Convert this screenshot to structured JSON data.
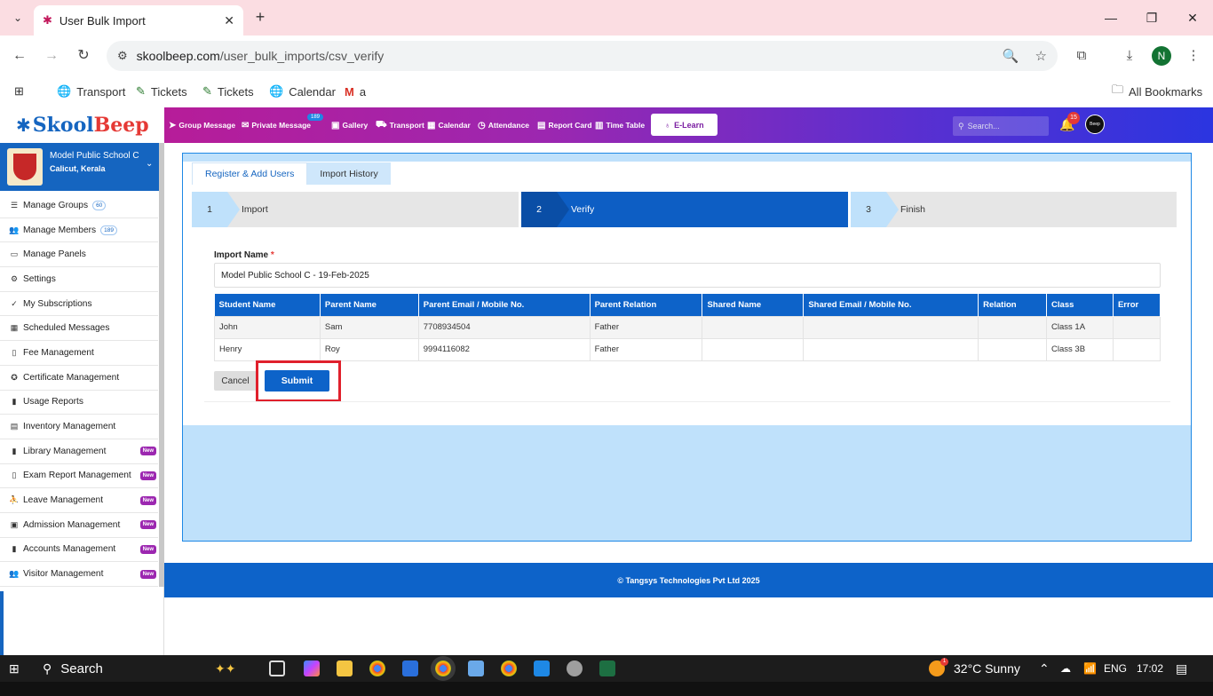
{
  "browser": {
    "tab_title": "User Bulk Import",
    "url_host": "skoolbeep.com",
    "url_path": "/user_bulk_imports/csv_verify",
    "profile_initial": "N",
    "bookmarks": [
      "Transport",
      "Tickets",
      "Tickets",
      "Calendar",
      "a"
    ],
    "all_bookmarks": "All Bookmarks"
  },
  "app": {
    "logo_skool": "Skool",
    "logo_beep": "Beep",
    "nav": [
      "Group Message",
      "Private Message",
      "Gallery",
      "Transport",
      "Calendar",
      "Attendance",
      "Report Card",
      "Time Table"
    ],
    "private_message_badge": "189",
    "elearn": "E-Learn",
    "search_placeholder": "Search...",
    "notification_count": "15",
    "avatar_text": "Beep"
  },
  "sidebar": {
    "school_name": "Model Public School C",
    "school_location": "Calicut, Kerala",
    "items": [
      {
        "label": "Manage Groups",
        "count": "60",
        "icon": "list-icon"
      },
      {
        "label": "Manage Members",
        "count": "189",
        "icon": "users-icon"
      },
      {
        "label": "Manage Panels",
        "icon": "monitor-icon"
      },
      {
        "label": "Settings",
        "icon": "gear-icon"
      },
      {
        "label": "My Subscriptions",
        "icon": "check-icon"
      },
      {
        "label": "Scheduled Messages",
        "icon": "calendar-icon"
      },
      {
        "label": "Fee Management",
        "icon": "doc-icon"
      },
      {
        "label": "Certificate Management",
        "icon": "award-icon"
      },
      {
        "label": "Usage Reports",
        "icon": "chart-icon"
      },
      {
        "label": "Inventory Management",
        "icon": "box-icon"
      },
      {
        "label": "Library Management",
        "badge": "New",
        "icon": "book-icon"
      },
      {
        "label": "Exam Report Management",
        "badge": "New",
        "icon": "file-icon"
      },
      {
        "label": "Leave Management",
        "badge": "New",
        "icon": "leave-icon"
      },
      {
        "label": "Admission Management",
        "badge": "New",
        "icon": "admission-icon"
      },
      {
        "label": "Accounts Management",
        "badge": "New",
        "icon": "accounts-icon"
      },
      {
        "label": "Visitor Management",
        "badge": "New",
        "icon": "visitor-icon"
      }
    ]
  },
  "main": {
    "tabs": [
      "Register & Add Users",
      "Import History"
    ],
    "steps": [
      {
        "num": "1",
        "label": "Import"
      },
      {
        "num": "2",
        "label": "Verify"
      },
      {
        "num": "3",
        "label": "Finish"
      }
    ],
    "import_name_label": "Import Name",
    "import_name_required": "*",
    "import_name_value": "Model Public School C - 19-Feb-2025",
    "table": {
      "headers": [
        "Student Name",
        "Parent Name",
        "Parent Email / Mobile No.",
        "Parent Relation",
        "Shared Name",
        "Shared Email / Mobile No.",
        "Relation",
        "Class",
        "Error"
      ],
      "rows": [
        [
          "John",
          "Sam",
          "7708934504",
          "Father",
          "",
          "",
          "",
          "Class 1A",
          ""
        ],
        [
          "Henry",
          "Roy",
          "9994116082",
          "Father",
          "",
          "",
          "",
          "Class 3B",
          ""
        ]
      ]
    },
    "cancel_label": "Cancel",
    "submit_label": "Submit"
  },
  "footer": "© Tangsys Technologies Pvt Ltd 2025",
  "taskbar": {
    "search": "Search",
    "weather": "32°C  Sunny",
    "lang": "ENG",
    "time": "17:02",
    "weather_badge": "1"
  }
}
